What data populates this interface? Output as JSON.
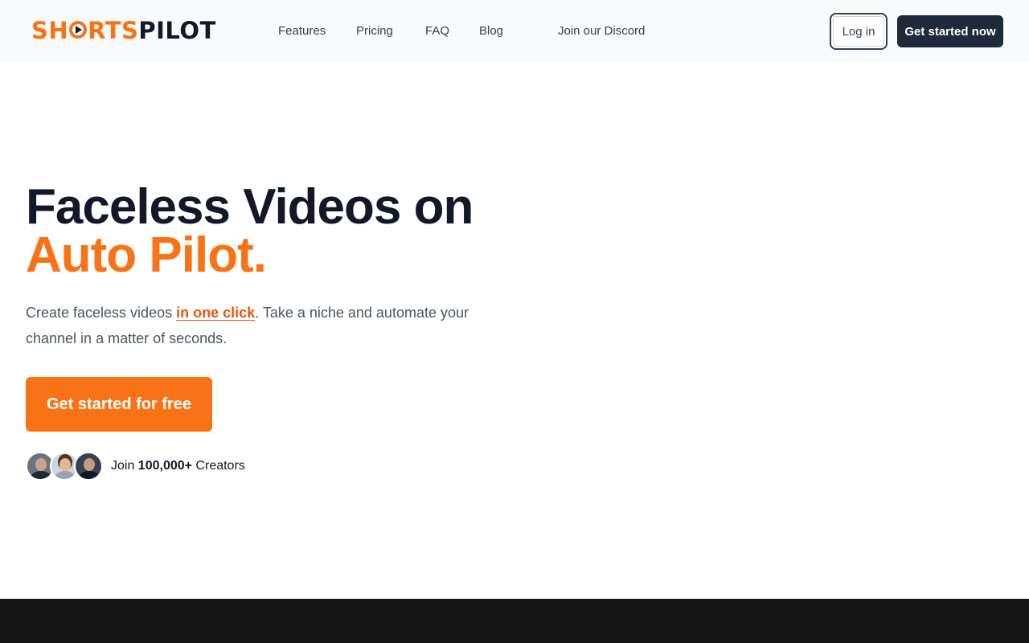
{
  "brand": {
    "logo_part1": "SHORTS",
    "logo_part2": "PILOT",
    "accent_color": "#f97316",
    "dark_color": "#1e293b"
  },
  "nav": {
    "items": [
      {
        "label": "Features"
      },
      {
        "label": "Pricing"
      },
      {
        "label": "FAQ"
      },
      {
        "label": "Blog"
      },
      {
        "label": "Join our Discord"
      }
    ],
    "login_label": "Log in",
    "cta_label": "Get started now"
  },
  "hero": {
    "title_line1": "Faceless Videos on",
    "title_line2": "Auto Pilot.",
    "subtitle_pre": "Create faceless videos ",
    "subtitle_highlight": "in one click",
    "subtitle_post": ". Take a niche and automate your channel in a matter of seconds.",
    "cta_label": "Get started for free",
    "proof_pre": "Join ",
    "proof_count": "100,000+",
    "proof_post": " Creators"
  }
}
